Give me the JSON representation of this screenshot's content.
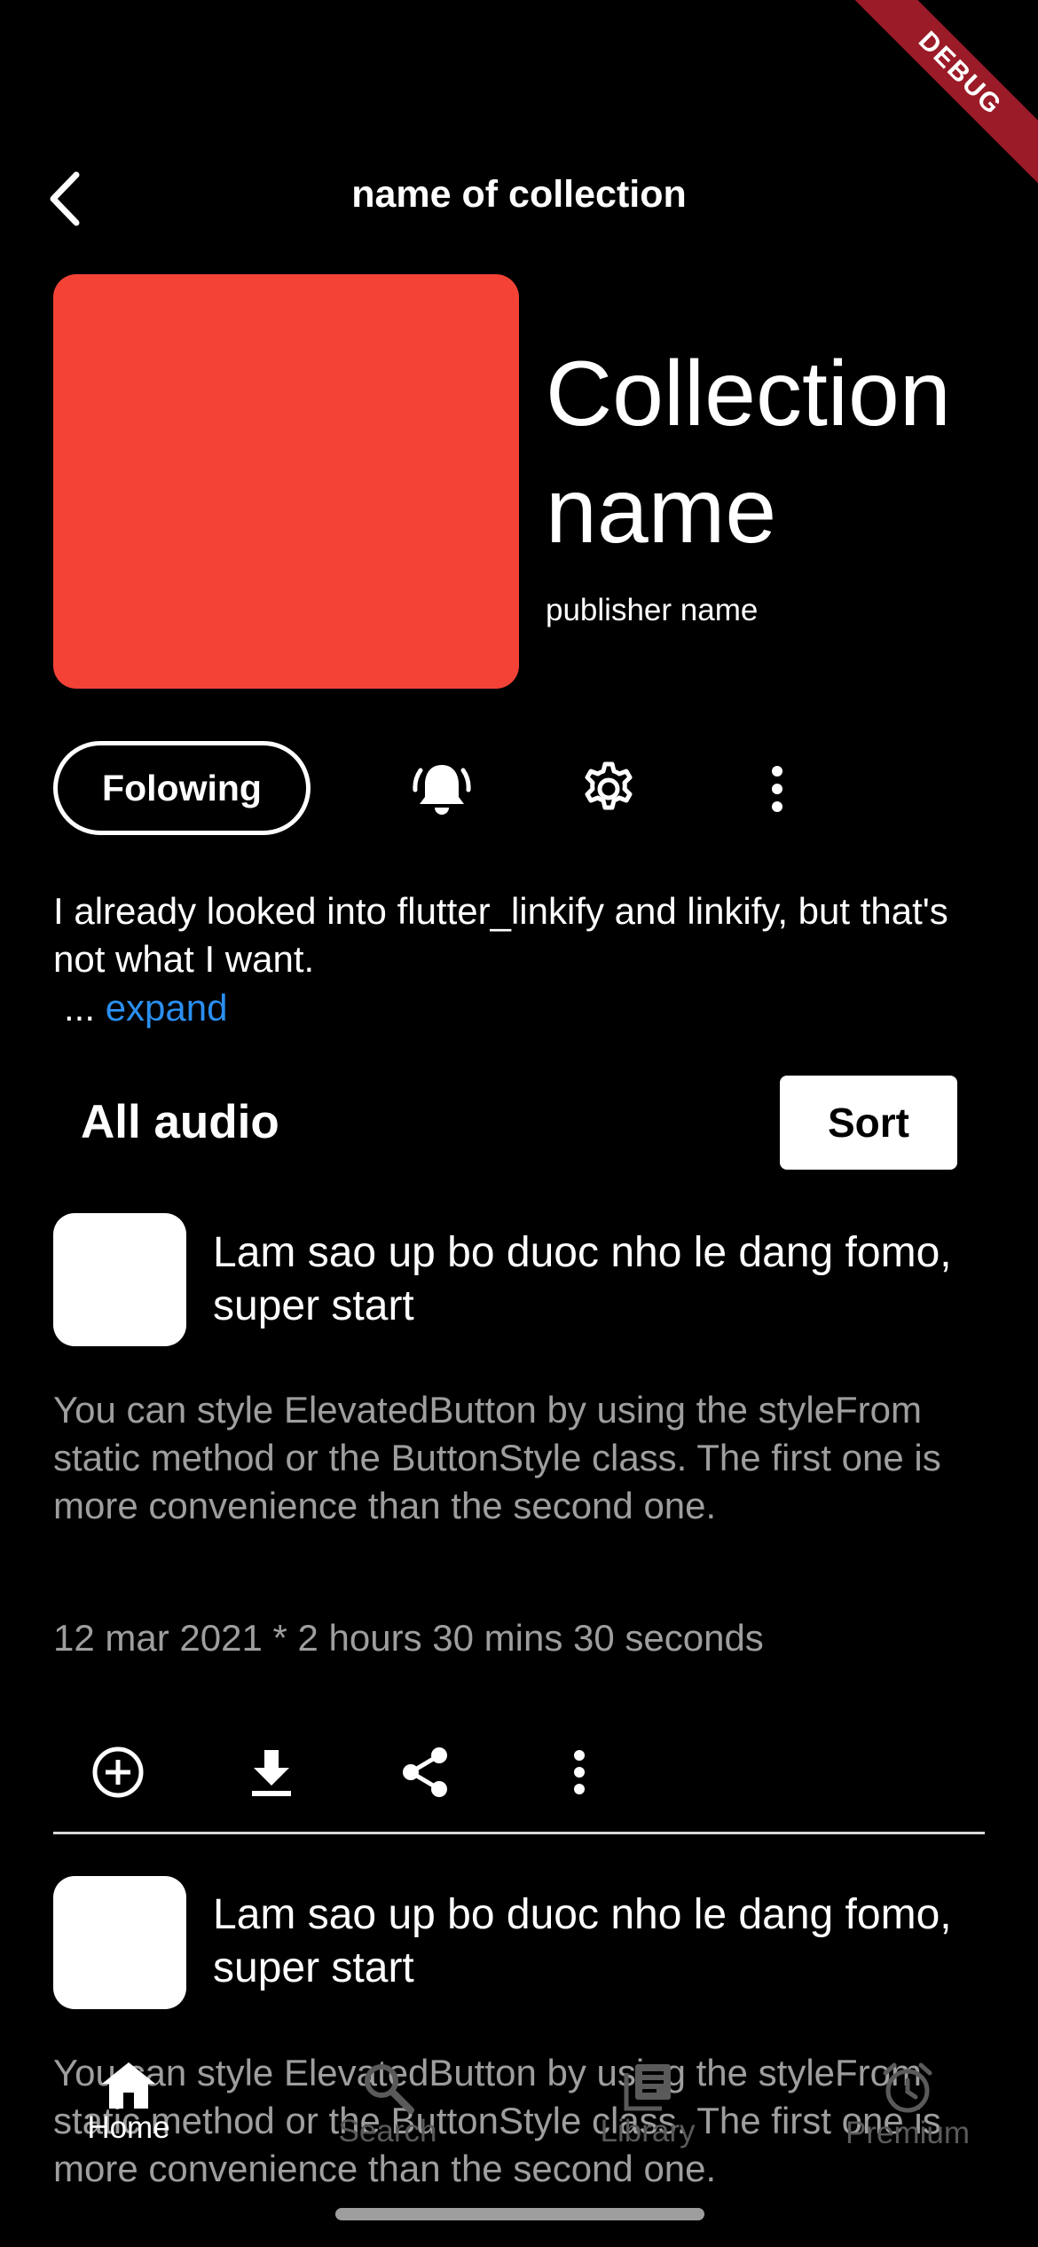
{
  "debug_banner": "DEBUG",
  "header": {
    "title": "name of collection"
  },
  "collection": {
    "name": "Collection name",
    "publisher": "publisher name",
    "cover_color": "#f44336"
  },
  "actions": {
    "follow_label": "Folowing",
    "icons": [
      "bell-ring-icon",
      "gear-icon",
      "more-vertical-icon"
    ]
  },
  "description": {
    "text": "I already looked into flutter_linkify and linkify, but that's not what I want.",
    "ellipsis": "...",
    "expand_label": "expand"
  },
  "section": {
    "title": "All audio",
    "sort_label": "Sort"
  },
  "episodes": [
    {
      "title": "Lam sao up bo duoc nho le dang fomo, super start",
      "description": "You can style ElevatedButton by using the styleFrom static method or the ButtonStyle class. The first one is more convenience than the second one.",
      "meta": "12 mar 2021 * 2 hours 30 mins 30 seconds",
      "actions": [
        "add-circle-icon",
        "download-icon",
        "share-icon",
        "more-vertical-icon"
      ]
    },
    {
      "title": "Lam sao up bo duoc nho le dang fomo, super start",
      "description": "You can style ElevatedButton by using the styleFrom static method or the ButtonStyle class. The first one is more convenience than the second one."
    }
  ],
  "bottom_nav": {
    "items": [
      {
        "label": "Home",
        "icon": "home-icon",
        "active": true
      },
      {
        "label": "Search",
        "icon": "search-icon",
        "active": false
      },
      {
        "label": "Library",
        "icon": "library-icon",
        "active": false
      },
      {
        "label": "Premium",
        "icon": "alarm-clock-icon",
        "active": false
      }
    ]
  },
  "colors": {
    "background": "#000000",
    "accent_link": "#2a8ff0",
    "secondary_text": "#9e9e9e",
    "nav_inactive": "#5a5a5a",
    "debug_ribbon": "#9b1b28"
  }
}
